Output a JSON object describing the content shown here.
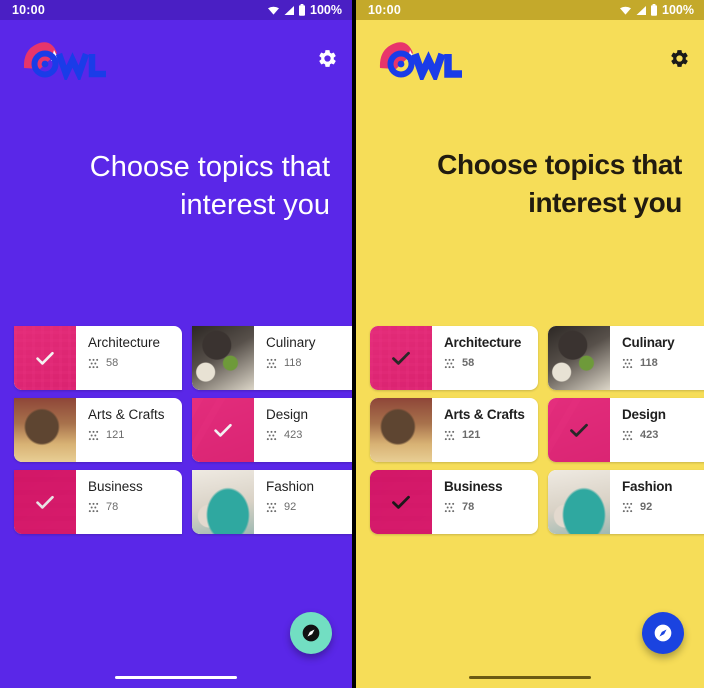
{
  "panels": [
    {
      "theme": "owl-purple",
      "status": {
        "time": "10:00",
        "battery": "100%"
      },
      "brand": {
        "name": "OWL"
      },
      "headline": "Choose topics that interest you",
      "settings_label": "Settings",
      "fab_label": "Explore",
      "cards": [
        {
          "title": "Architecture",
          "count": "58",
          "selected": true
        },
        {
          "title": "Culinary",
          "count": "118",
          "selected": false
        },
        {
          "title": "Arts & Crafts",
          "count": "121",
          "selected": false
        },
        {
          "title": "Design",
          "count": "423",
          "selected": true
        },
        {
          "title": "Business",
          "count": "78",
          "selected": true
        },
        {
          "title": "Fashion",
          "count": "92",
          "selected": false
        }
      ]
    },
    {
      "theme": "owl-yellow",
      "status": {
        "time": "10:00",
        "battery": "100%"
      },
      "brand": {
        "name": "OWL"
      },
      "headline": "Choose topics that interest you",
      "settings_label": "Settings",
      "fab_label": "Explore",
      "cards": [
        {
          "title": "Architecture",
          "count": "58",
          "selected": true
        },
        {
          "title": "Culinary",
          "count": "118",
          "selected": false
        },
        {
          "title": "Arts & Crafts",
          "count": "121",
          "selected": false
        },
        {
          "title": "Design",
          "count": "423",
          "selected": true
        },
        {
          "title": "Business",
          "count": "78",
          "selected": true
        },
        {
          "title": "Fashion",
          "count": "92",
          "selected": false
        }
      ]
    }
  ],
  "colors": {
    "purple_bg": "#5A27E8",
    "purple_statusbar": "#4A1FC4",
    "yellow_bg": "#F6DD58",
    "yellow_statusbar": "#C4A92B",
    "selection_pink": "#E8126E",
    "logo_pink": "#E8356B",
    "logo_blue": "#1A3CE8",
    "fab_teal": "#72DEC2",
    "fab_blue": "#1A43E0",
    "card_white": "#FFFFFF",
    "text_dark": "#1F1F1F",
    "meta_gray": "#6B6B6B"
  },
  "icons": {
    "wifi": "wifi-icon",
    "signal": "signal-icon",
    "battery": "battery-icon",
    "settings": "gear-icon",
    "check": "check-icon",
    "grain": "grain-icon",
    "explore": "compass-icon"
  }
}
